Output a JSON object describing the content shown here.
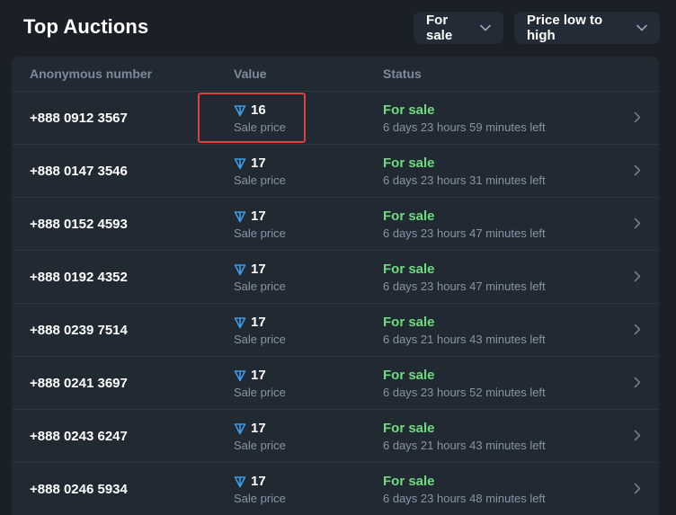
{
  "header": {
    "title": "Top Auctions",
    "filter_label": "For sale",
    "sort_label": "Price low to high"
  },
  "table": {
    "columns": {
      "number": "Anonymous number",
      "value": "Value",
      "status": "Status"
    },
    "rows": [
      {
        "number": "+888 0912 3567",
        "value": "16",
        "value_sub": "Sale price",
        "status": "For sale",
        "time_left": "6 days 23 hours 59 minutes left"
      },
      {
        "number": "+888 0147 3546",
        "value": "17",
        "value_sub": "Sale price",
        "status": "For sale",
        "time_left": "6 days 23 hours 31 minutes left"
      },
      {
        "number": "+888 0152 4593",
        "value": "17",
        "value_sub": "Sale price",
        "status": "For sale",
        "time_left": "6 days 23 hours 47 minutes left"
      },
      {
        "number": "+888 0192 4352",
        "value": "17",
        "value_sub": "Sale price",
        "status": "For sale",
        "time_left": "6 days 23 hours 47 minutes left"
      },
      {
        "number": "+888 0239 7514",
        "value": "17",
        "value_sub": "Sale price",
        "status": "For sale",
        "time_left": "6 days 21 hours 43 minutes left"
      },
      {
        "number": "+888 0241 3697",
        "value": "17",
        "value_sub": "Sale price",
        "status": "For sale",
        "time_left": "6 days 23 hours 52 minutes left"
      },
      {
        "number": "+888 0243 6247",
        "value": "17",
        "value_sub": "Sale price",
        "status": "For sale",
        "time_left": "6 days 21 hours 43 minutes left"
      },
      {
        "number": "+888 0246 5934",
        "value": "17",
        "value_sub": "Sale price",
        "status": "For sale",
        "time_left": "6 days 23 hours 48 minutes left"
      }
    ]
  },
  "icons": {
    "currency": "ton-icon",
    "dropdown": "chevron-down-icon",
    "row_action": "chevron-right-icon"
  },
  "colors": {
    "background": "#1a2026",
    "panel": "#212a33",
    "status_green": "#6fdb7f",
    "ton_blue": "#3f9be8",
    "highlight_red": "#d7443c"
  }
}
